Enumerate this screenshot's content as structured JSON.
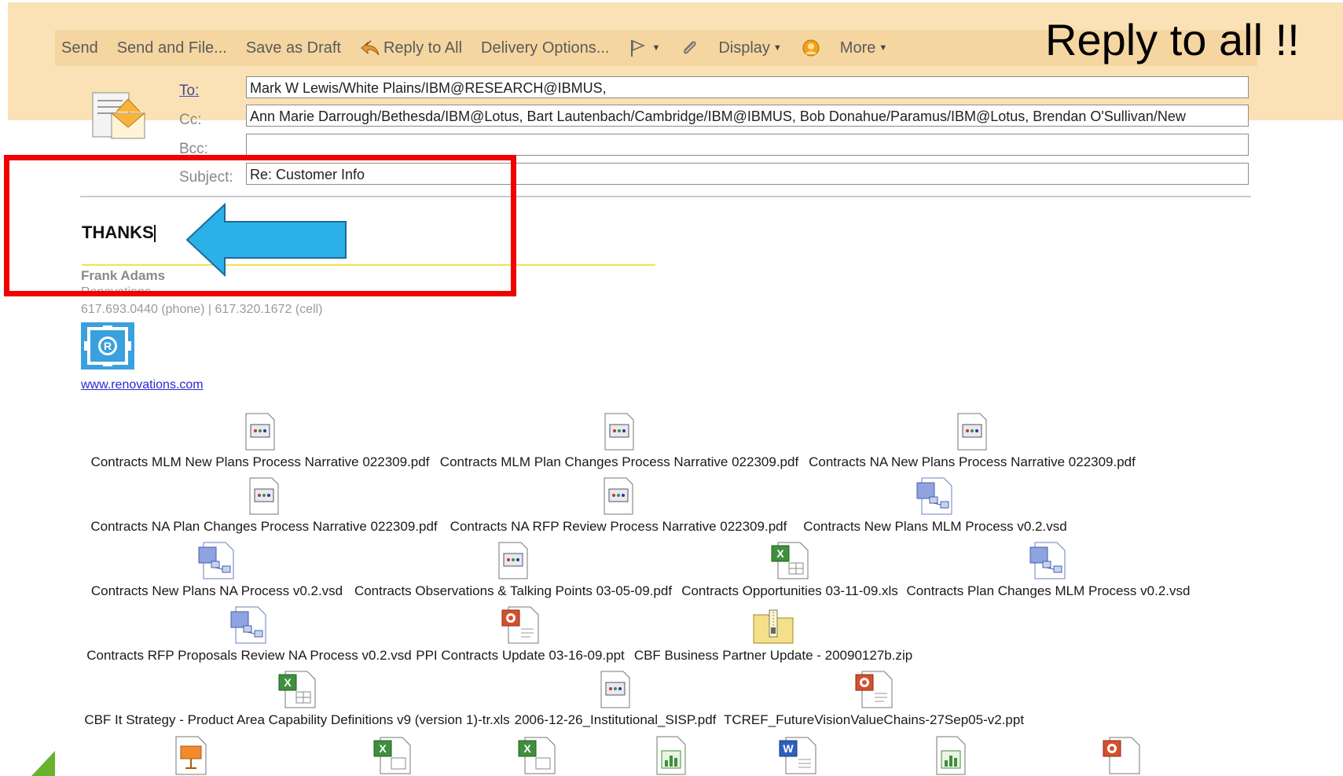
{
  "headline": "Reply to all !!",
  "toolbar": {
    "send": "Send",
    "send_and_file": "Send and File...",
    "save_as_draft": "Save as Draft",
    "reply_to_all": "Reply to All",
    "delivery_options": "Delivery Options...",
    "display": "Display",
    "more": "More"
  },
  "header": {
    "to_label": "To:",
    "cc_label": "Cc:",
    "bcc_label": "Bcc:",
    "subject_label": "Subject:",
    "to_value": "Mark W Lewis/White Plains/IBM@RESEARCH@IBMUS,",
    "cc_value": "Ann Marie Darrough/Bethesda/IBM@Lotus, Bart Lautenbach/Cambridge/IBM@IBMUS, Bob Donahue/Paramus/IBM@Lotus, Brendan O'Sullivan/New",
    "bcc_value": "",
    "subject_value": "Re: Customer Info"
  },
  "body": {
    "text": "THANKS"
  },
  "signature": {
    "name": "Frank Adams",
    "company": "Renovations",
    "phone": "617.693.0440 (phone) | 617.320.1672 (cell)",
    "website": "www.renovations.com"
  },
  "attachments": [
    [
      {
        "name": "Contracts MLM New Plans Process Narrative 022309.pdf",
        "icon": "pdf-icon"
      },
      {
        "name": "Contracts MLM Plan Changes Process Narrative 022309.pdf",
        "icon": "pdf-icon"
      },
      {
        "name": "Contracts NA New Plans Process Narrative 022309.pdf",
        "icon": "pdf-icon"
      }
    ],
    [
      {
        "name": "Contracts NA Plan Changes Process Narrative 022309.pdf",
        "icon": "pdf-icon"
      },
      {
        "name": "Contracts NA RFP Review Process Narrative 022309.pdf",
        "icon": "pdf-icon"
      },
      {
        "name": "Contracts New Plans MLM Process v0.2.vsd",
        "icon": "visio-icon"
      }
    ],
    [
      {
        "name": "Contracts New Plans NA Process v0.2.vsd",
        "icon": "visio-icon"
      },
      {
        "name": "Contracts Observations & Talking Points 03-05-09.pdf",
        "icon": "pdf-icon"
      },
      {
        "name": "Contracts Opportunities 03-11-09.xls",
        "icon": "excel-icon"
      },
      {
        "name": "Contracts Plan Changes MLM Process v0.2.vsd",
        "icon": "visio-icon"
      }
    ],
    [
      {
        "name": "Contracts RFP Proposals Review NA Process v0.2.vsd",
        "icon": "visio-icon"
      },
      {
        "name": "PPI Contracts Update 03-16-09.ppt",
        "icon": "ppt-icon"
      },
      {
        "name": "CBF Business Partner Update -  20090127b.zip",
        "icon": "zip-icon"
      }
    ],
    [
      {
        "name": "CBF It Strategy - Product Area Capability Definitions v9 (version 1)-tr.xls",
        "icon": "excel-icon"
      },
      {
        "name": "2006-12-26_Institutional_SISP.pdf",
        "icon": "pdf-icon"
      },
      {
        "name": "TCREF_FutureVisionValueChains-27Sep05-v2.ppt",
        "icon": "ppt-icon"
      }
    ]
  ],
  "bottom_icons": [
    "presentation-icon",
    "excel-icon",
    "excel-icon",
    "chart-icon",
    "word-icon",
    "chart-icon",
    "ppt-icon"
  ],
  "colors": {
    "banner": "#fbe2b6",
    "toolbar": "#f5d6a1",
    "highlight_box": "#f00000",
    "arrow": "#2bb1e8",
    "link": "#2a2ad0"
  }
}
